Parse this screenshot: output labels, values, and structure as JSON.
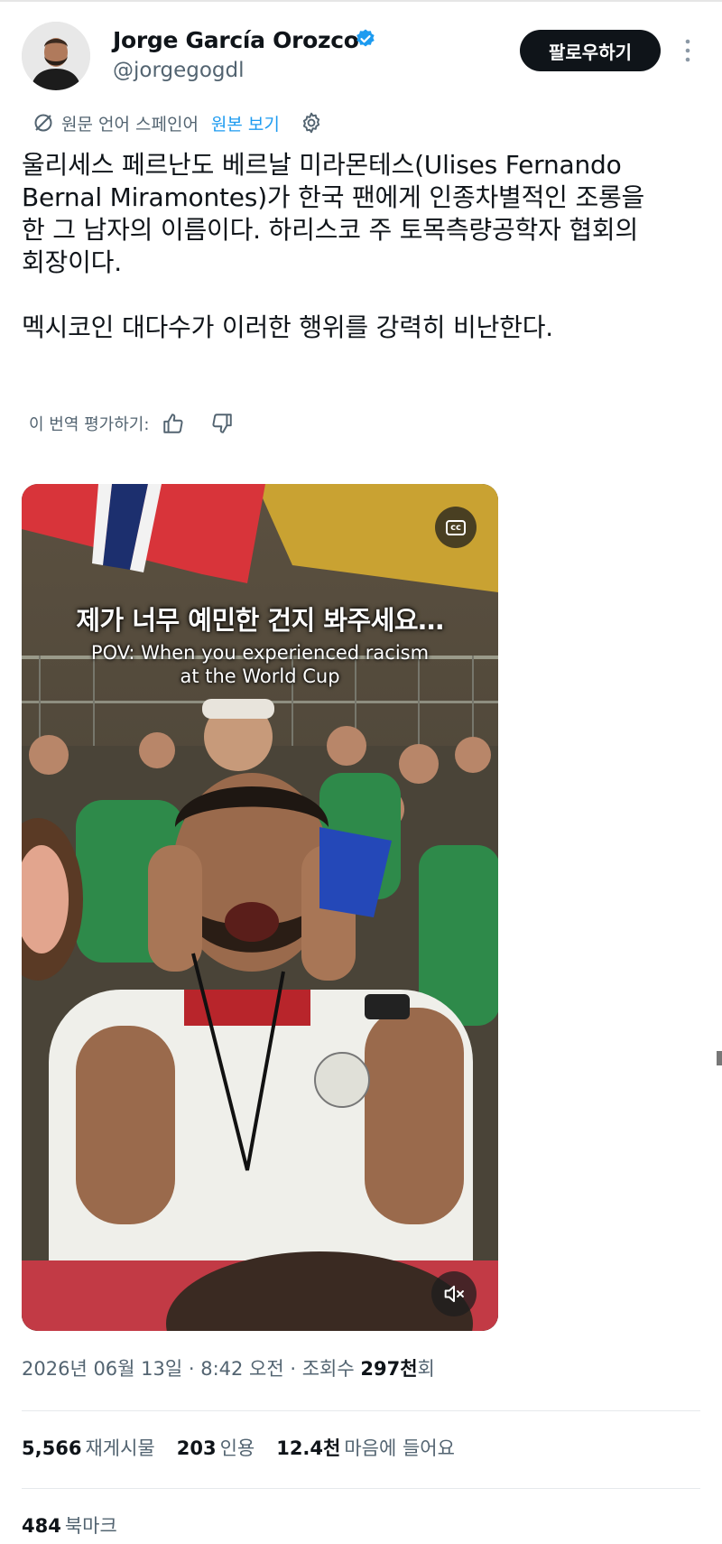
{
  "author": {
    "name": "Jorge García Orozco",
    "handle": "@jorgegogdl",
    "follow_label": "팔로우하기"
  },
  "translation": {
    "source_language": "원문 언어 스페인어",
    "view_original": "원본 보기"
  },
  "tweet": {
    "text": "울리세스 페르난도 베르날 미라몬테스(Ulises Fernando\nBernal Miramontes)가 한국 팬에게 인종차별적인 조롱을\n한 그 남자의 이름이다. 하리스코 주 토목측량공학자 협회의\n회장이다.\n\n멕시코인 대다수가 이러한 행위를 강력히 비난한다.",
    "rate_translation": "이 번역 평가하기:"
  },
  "media": {
    "caption_ko": "제가 너무 예민한 건지 봐주세요…",
    "caption_en": "POV: When you experienced racism\nat the World Cup",
    "cc_label": "cc"
  },
  "meta": {
    "date": "2026년 06월 13일 · 8:42 오전 · 조회수 ",
    "views": "297천",
    "views_suffix": "회"
  },
  "stats": {
    "reposts": {
      "count": "5,566",
      "label": "재게시물"
    },
    "quotes": {
      "count": "203",
      "label": "인용"
    },
    "likes": {
      "count": "12.4천",
      "label": "마음에 들어요"
    },
    "bookmarks": {
      "count": "484",
      "label": "북마크"
    }
  },
  "colors": {
    "accent": "#1d9bf0",
    "text": "#0f1419",
    "secondary": "#536471"
  },
  "icons": [
    "verified-icon",
    "more-icon",
    "translate-icon",
    "settings-icon",
    "thumbs-up-icon",
    "thumbs-down-icon",
    "cc-icon",
    "mute-icon"
  ]
}
